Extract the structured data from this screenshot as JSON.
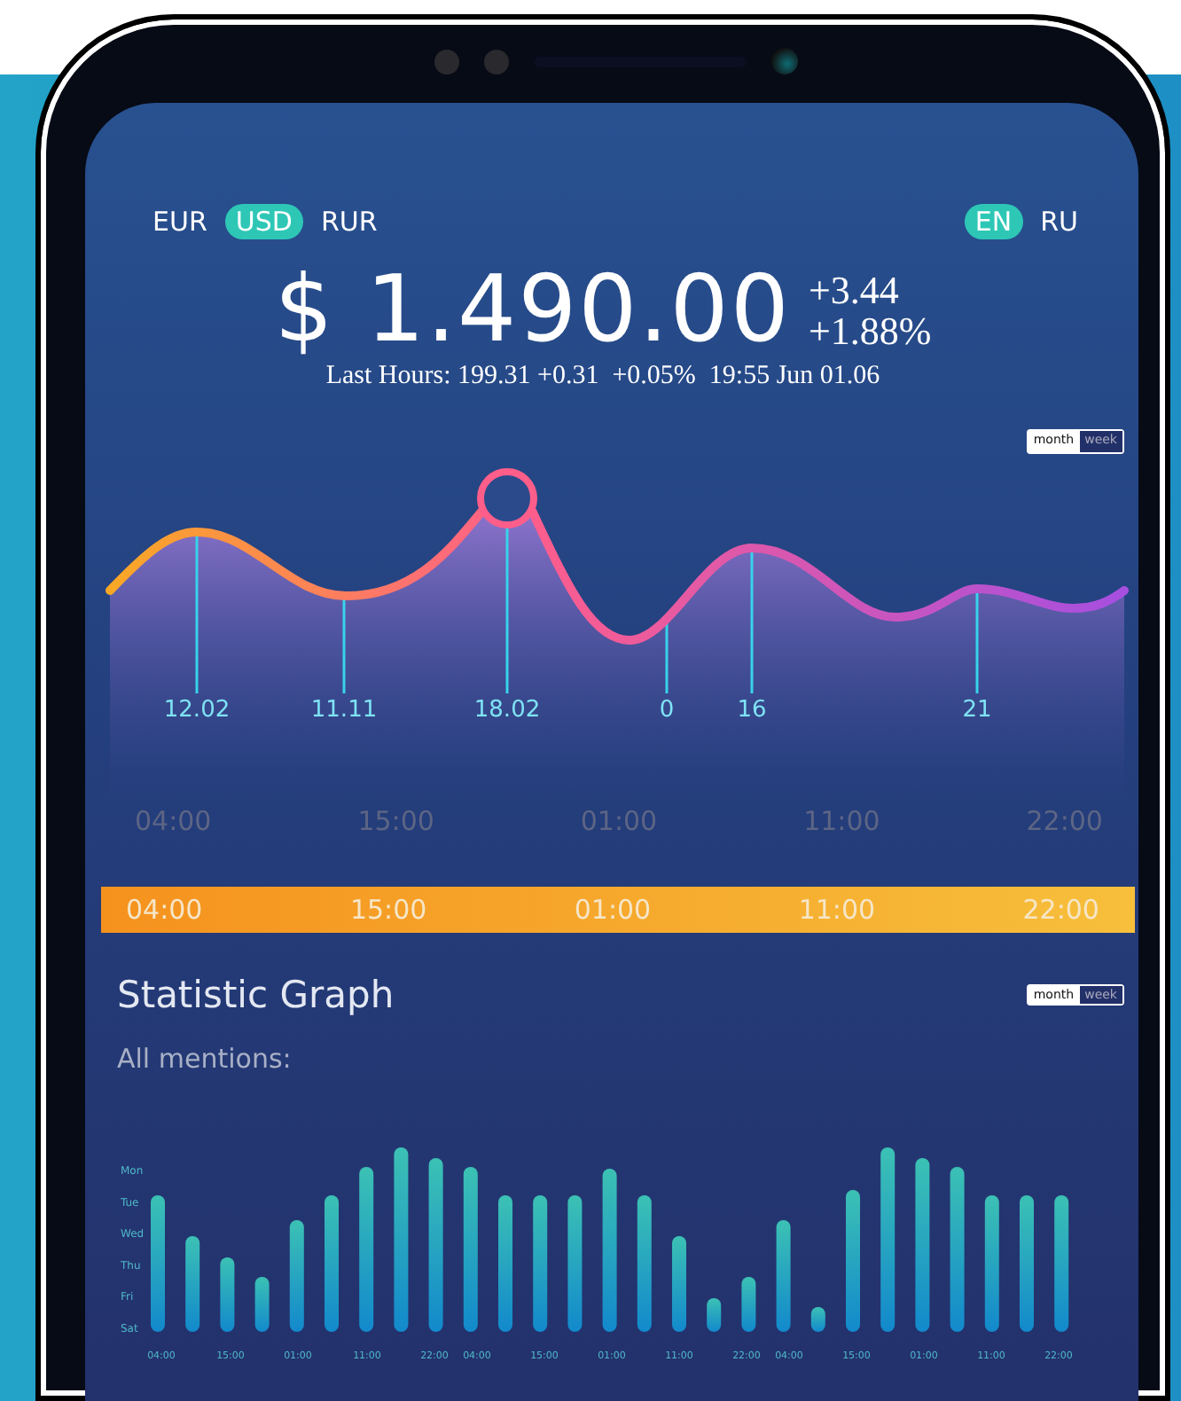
{
  "currencies": [
    {
      "label": "EUR",
      "selected": false
    },
    {
      "label": "USD",
      "selected": true
    },
    {
      "label": "RUR",
      "selected": false
    }
  ],
  "languages": [
    {
      "label": "EN",
      "selected": true
    },
    {
      "label": "RU",
      "selected": false
    }
  ],
  "price": {
    "value": "$ 1.490.00",
    "change_abs": "+3.44",
    "change_pct": "+1.88%",
    "last_hours": "Last Hours: 199.31 +0.31  +0.05%  19:55 Jun 01.06"
  },
  "price_chart": {
    "period_toggle": [
      {
        "label": "month",
        "selected": true
      },
      {
        "label": "week",
        "selected": false
      }
    ],
    "markers": [
      "12.02",
      "11.11",
      "18.02",
      "0",
      "16",
      "21"
    ],
    "time_labels": [
      "04:00",
      "15:00",
      "01:00",
      "11:00",
      "22:00"
    ]
  },
  "time_strip": {
    "labels": [
      "04:00",
      "15:00",
      "01:00",
      "11:00",
      "22:00"
    ]
  },
  "statistic": {
    "title": "Statistic Graph",
    "subtitle": "All mentions:",
    "period_toggle": [
      {
        "label": "month",
        "selected": true
      },
      {
        "label": "week",
        "selected": false
      }
    ],
    "day_labels": [
      "Mon",
      "Tue",
      "Wed",
      "Thu",
      "Fri",
      "Sat"
    ],
    "time_labels": [
      "04:00",
      "15:00",
      "01:00",
      "11:00",
      "22:00",
      "04:00",
      "15:00",
      "01:00",
      "11:00",
      "22:00",
      "04:00",
      "15:00",
      "01:00",
      "11:00",
      "22:00"
    ]
  }
}
